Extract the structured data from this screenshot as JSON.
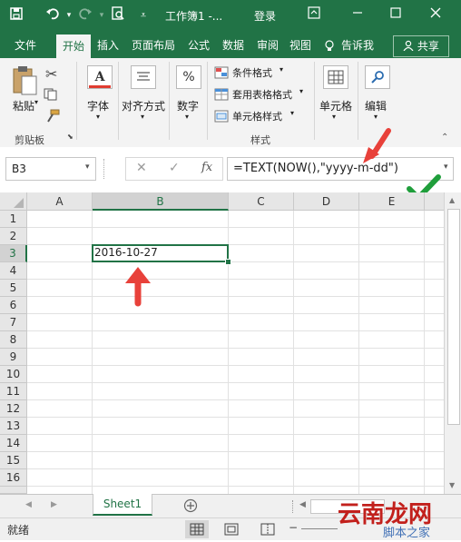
{
  "titlebar": {
    "document_title": "工作簿1  -...",
    "login_label": "登录"
  },
  "tabs": [
    "文件",
    "开始",
    "插入",
    "页面布局",
    "公式",
    "数据",
    "审阅",
    "视图"
  ],
  "tell_me_label": "告诉我",
  "share_label": "共享",
  "ribbon": {
    "paste_label": "粘贴",
    "clipboard_group": "剪贴板",
    "font_label": "字体",
    "alignment_label": "对齐方式",
    "number_label": "数字",
    "conditional_format_label": "条件格式",
    "table_format_label": "套用表格格式",
    "cell_style_label": "单元格样式",
    "styles_group": "样式",
    "cells_label": "单元格",
    "editing_label": "编辑"
  },
  "formula_bar": {
    "name_box": "B3",
    "fx_label": "fx",
    "formula": "=TEXT(NOW(),\"yyyy-m-dd\")"
  },
  "grid": {
    "columns": [
      "A",
      "B",
      "C",
      "D",
      "E"
    ],
    "rows": [
      "1",
      "2",
      "3",
      "4",
      "5",
      "6",
      "7",
      "8",
      "9",
      "10",
      "11",
      "12",
      "13",
      "14",
      "15",
      "16"
    ],
    "b3_value": "2016-10-27"
  },
  "sheet_tab": "Sheet1",
  "add_sheet_icon": "plus-circle-icon",
  "status_text": "就绪",
  "watermark_text": "云南龙网",
  "watermark_sub": "脚本之家",
  "colors": {
    "excel_green": "#217346",
    "arrow_red": "#e8413a",
    "check_green": "#1f9e3b"
  }
}
